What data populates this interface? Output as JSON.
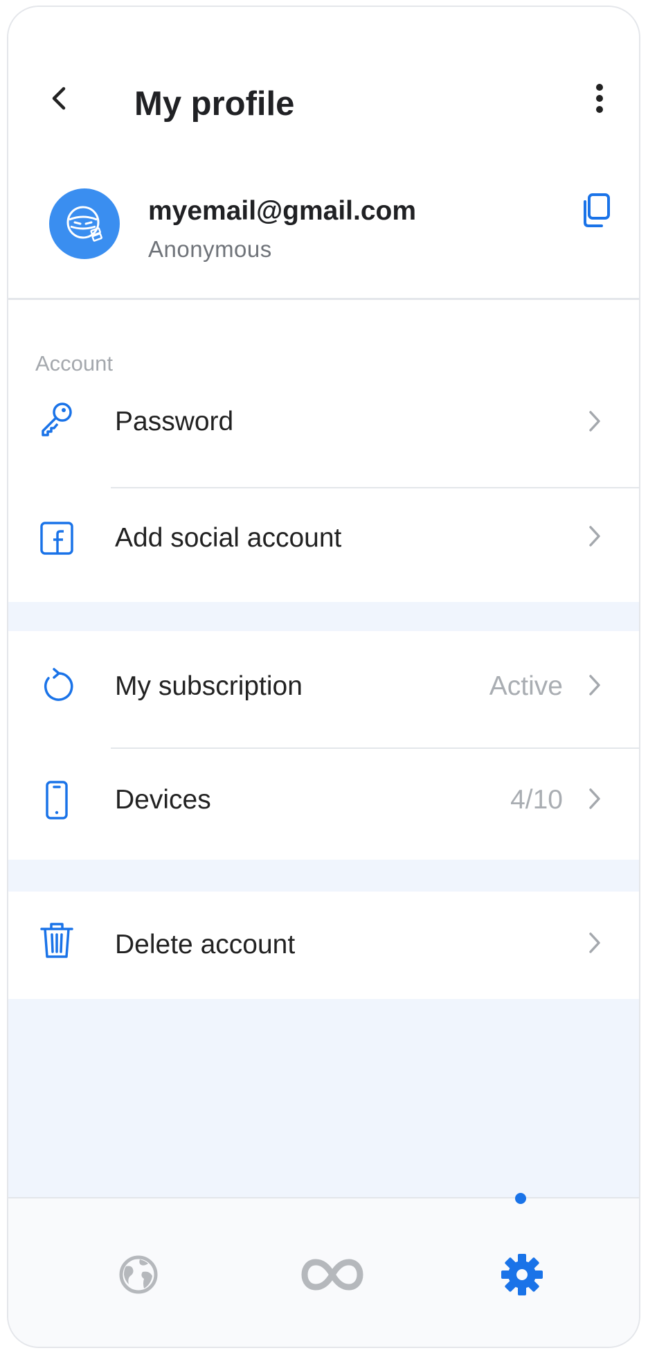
{
  "header": {
    "title": "My profile",
    "back_icon": "chevron-left-icon",
    "more_icon": "more-vertical-icon"
  },
  "profile": {
    "email": "myemail@gmail.com",
    "status": "Anonymous",
    "avatar_icon": "ninja-avatar-icon",
    "copy_icon": "copy-icon"
  },
  "account_section": {
    "label": "Account",
    "items": [
      {
        "label": "Password",
        "icon": "key-icon",
        "value": ""
      },
      {
        "label": "Add social account",
        "icon": "facebook-icon",
        "value": ""
      }
    ]
  },
  "subscription_section": {
    "items": [
      {
        "label": "My subscription",
        "icon": "refresh-icon",
        "value": "Active"
      },
      {
        "label": "Devices",
        "icon": "phone-icon",
        "value": "4/10"
      }
    ]
  },
  "danger_section": {
    "items": [
      {
        "label": "Delete account",
        "icon": "trash-icon",
        "value": ""
      }
    ]
  },
  "bottom_nav": {
    "items": [
      {
        "icon": "globe-icon",
        "active": false
      },
      {
        "icon": "infinity-icon",
        "active": false
      },
      {
        "icon": "gear-icon",
        "active": true
      }
    ]
  },
  "colors": {
    "accent": "#1a73e8",
    "avatar_bg": "#3a8ef0",
    "background": "#f0f5fd",
    "muted_text": "#a9adb2",
    "inactive_icon": "#b5b8bc"
  }
}
